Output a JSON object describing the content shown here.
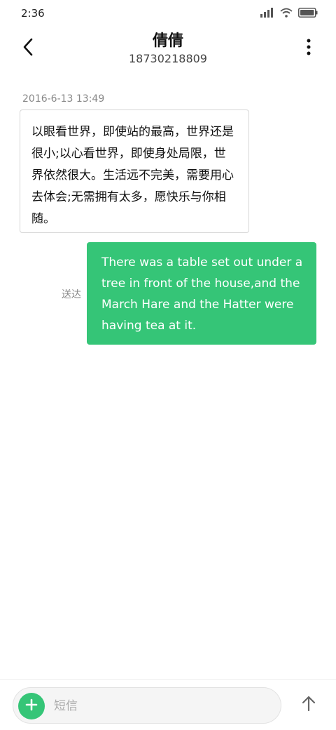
{
  "status_bar": {
    "time": "2:36",
    "icons": [
      "signal-icon",
      "wifi-icon",
      "battery-icon"
    ]
  },
  "header": {
    "contact_name": "倩倩",
    "contact_number": "18730218809",
    "back_icon": "back-arrow-icon",
    "more_icon": "more-vertical-icon"
  },
  "conversation": {
    "timestamp": "2016-6-13 13:49",
    "incoming_message": "以眼看世界，即使站的最高，世界还是很小;以心看世界，即使身处局限，世界依然很大。生活远不完美，需要用心去体会;无需拥有太多，愿快乐与你相随。",
    "outgoing_message": "There was a table set out under a tree in front of the house,and the March Hare and the Hatter were having tea at it.",
    "outgoing_status": "送达"
  },
  "composer": {
    "placeholder": "短信",
    "value": "",
    "add_icon": "plus-icon",
    "send_icon": "send-arrow-up-icon"
  },
  "colors": {
    "accent": "#35c577",
    "outgoing_text": "#ffffff",
    "muted_text": "#888888"
  }
}
